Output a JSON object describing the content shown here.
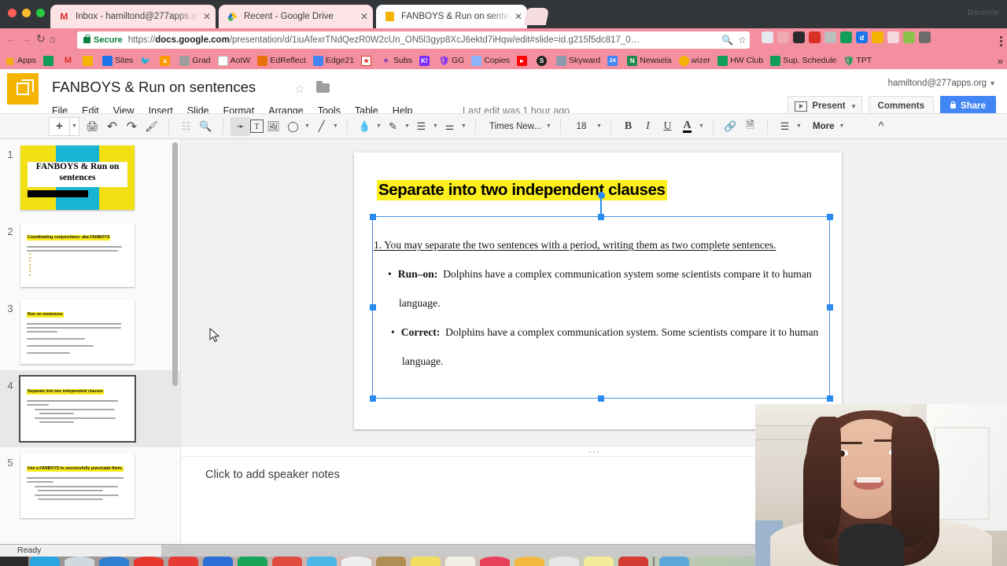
{
  "browser": {
    "window_controls": [
      "close",
      "minimize",
      "maximize"
    ],
    "profile_label": "Danielle",
    "tabs": [
      {
        "title": "Inbox - hamiltond@277apps.o",
        "favicon": "gmail-icon",
        "active": false
      },
      {
        "title": "Recent - Google Drive",
        "favicon": "google-drive-icon",
        "active": false
      },
      {
        "title": "FANBOYS & Run on sentences",
        "favicon": "google-slides-icon",
        "active": true
      }
    ],
    "nav": {
      "back": "←",
      "forward": "→",
      "reload": "↻",
      "home": "⌂"
    },
    "omnibox": {
      "security_label": "Secure",
      "url_prefix": "https://",
      "url_domain": "docs.google.com",
      "url_path": "/presentation/d/1iuAfexrTNdQezR0W2cUn_ON5l3gyp8XcJ6ektd7iHqw/edit#slide=id.g215f5dc817_0…",
      "zoom_icon": "search-zoom-icon",
      "bookmark_icon": "star-icon"
    },
    "extensions": [
      "readability-ext",
      "drive-ext",
      "video-ext",
      "book-ext",
      "ghost-ext",
      "contacts-ext",
      "docs-ext",
      "drive2-ext",
      "whitespace-ext",
      "green-ext",
      "bulb-ext"
    ],
    "menu_icon": "kebab-menu-icon",
    "bookmarks": [
      {
        "label": "Apps",
        "icon": "apps-grid-icon",
        "color": "#f4b400"
      },
      {
        "label": "",
        "icon": "google-drive-icon",
        "color": "#0f9d58"
      },
      {
        "label": "",
        "icon": "gmail-icon",
        "color": "#d93025"
      },
      {
        "label": "",
        "icon": "contacts-icon",
        "color": "#f4b400"
      },
      {
        "label": "Sites",
        "icon": "google-sites-icon",
        "color": "#1a73e8"
      },
      {
        "label": "",
        "icon": "twitter-icon",
        "color": "#1da1f2"
      },
      {
        "label": "",
        "icon": "amazon-icon",
        "color": "#ff9900"
      },
      {
        "label": "Grad",
        "icon": "folder-icon",
        "color": "#9e9e9e"
      },
      {
        "label": "AotW",
        "icon": "page-icon",
        "color": "#9e9e9e"
      },
      {
        "label": "EdReflect",
        "icon": "edreflect-icon",
        "color": "#e8710a"
      },
      {
        "label": "Edge21",
        "icon": "edge21-icon",
        "color": "#4285f4"
      },
      {
        "label": "",
        "icon": "subs-red-icon",
        "color": "#d93025"
      },
      {
        "label": "Subs",
        "icon": "subs-purple-icon",
        "color": "#8e44ad"
      },
      {
        "label": "",
        "icon": "kahoot-icon",
        "color": "#7b2ff7"
      },
      {
        "label": "GG",
        "icon": "shield-icon",
        "color": "#7b2ff7"
      },
      {
        "label": "Copies",
        "icon": "copies-icon",
        "color": "#8ab4f8"
      },
      {
        "label": "",
        "icon": "youtube-icon",
        "color": "#ff0000"
      },
      {
        "label": "",
        "icon": "skype-icon",
        "color": "#00aff0"
      },
      {
        "label": "Skyward",
        "icon": "skyward-icon",
        "color": "#6d7b8d"
      },
      {
        "label": "",
        "icon": "24-icon",
        "color": "#4285f4"
      },
      {
        "label": "Newsela",
        "icon": "newsela-icon",
        "color": "#1f8a4c"
      },
      {
        "label": "wizer",
        "icon": "wizer-icon",
        "color": "#f4b400"
      },
      {
        "label": "HW Club",
        "icon": "sheets-icon",
        "color": "#0f9d58"
      },
      {
        "label": "Sup. Schedule",
        "icon": "sheets-icon",
        "color": "#0f9d58"
      },
      {
        "label": "TPT",
        "icon": "tpt-icon",
        "color": "#0f9d58"
      }
    ],
    "bookmarks_overflow": "»"
  },
  "slides_app": {
    "logo": "google-slides-logo",
    "doc_title": "FANBOYS & Run on sentences",
    "star_icon": "star-outline-icon",
    "folder_icon": "move-to-folder-icon",
    "menus": [
      "File",
      "Edit",
      "View",
      "Insert",
      "Slide",
      "Format",
      "Arrange",
      "Tools",
      "Table",
      "Help"
    ],
    "last_edit": "Last edit was 1 hour ago",
    "account": "hamiltond@277apps.org",
    "present_label": "Present",
    "comments_label": "Comments",
    "share_label": "Share",
    "toolbar": {
      "new_slide": "+",
      "print_icon": "print-icon",
      "undo_icon": "undo-icon",
      "redo_icon": "redo-icon",
      "paint_format_icon": "paint-format-icon",
      "layout_icon": "layout-icon",
      "zoom_icon": "zoom-icon",
      "select_icon": "select-arrow-icon",
      "textbox_icon": "text-box-icon",
      "image_icon": "insert-image-icon",
      "shape_icon": "shape-icon",
      "line_icon": "line-icon",
      "fill_icon": "fill-color-icon",
      "border_icon": "border-color-icon",
      "border_weight_icon": "border-weight-icon",
      "border_dash_icon": "border-dash-icon",
      "font_family": "Times New...",
      "font_size": "18",
      "bold": "B",
      "italic": "I",
      "underline": "U",
      "text_color": "A",
      "link_icon": "insert-link-icon",
      "comment_icon": "add-comment-icon",
      "align_icon": "align-icon",
      "more_label": "More",
      "collapse_icon": "collapse-chevrons-icon"
    }
  },
  "filmstrip": {
    "slides": [
      {
        "number": "1",
        "type": "title",
        "title_line1": "FANBOYS & Run on",
        "title_line2": "sentences"
      },
      {
        "number": "2",
        "type": "content",
        "title": "Coordinating conjunctions:  aka FANBOYS",
        "body_lines": 2,
        "bullets": 7
      },
      {
        "number": "3",
        "type": "content",
        "title": "Run on sentences",
        "body_lines": 3,
        "extra_lines": 3
      },
      {
        "number": "4",
        "type": "content",
        "title": "Separate into two independent clauses",
        "selected": true,
        "body_lines": 2,
        "bullets": 4
      },
      {
        "number": "5",
        "type": "content",
        "title": "Use a FANBOYS to successfully punctuate them.",
        "body_lines": 2,
        "bullets": 4
      }
    ]
  },
  "slide_canvas": {
    "title": "Separate into two independent clauses",
    "title_highlight": "#fdee1d",
    "paragraph": "1. You may separate the two sentences with a period, writing them as two complete sentences.",
    "bullets": [
      {
        "label": "Run–on:",
        "text": "Dolphins have a complex communication system some scientists compare it  to human language."
      },
      {
        "label": "Correct:",
        "text": "Dolphins have a complex communication system.  Some scientists compare it  to human language."
      }
    ],
    "selection": "body-text-box-selected"
  },
  "speaker_notes": {
    "placeholder": "Click to add speaker notes"
  },
  "status_bar": {
    "text": "Ready"
  },
  "dock": {
    "items": [
      "finder",
      "siri",
      "safari",
      "opera",
      "calendar",
      "docs",
      "sheets",
      "slides",
      "notability",
      "chrome",
      "contacts",
      "notes",
      "reminders",
      "itunes",
      "emoji",
      "settings",
      "stickies",
      "pdf",
      "divider",
      "downloads"
    ]
  }
}
